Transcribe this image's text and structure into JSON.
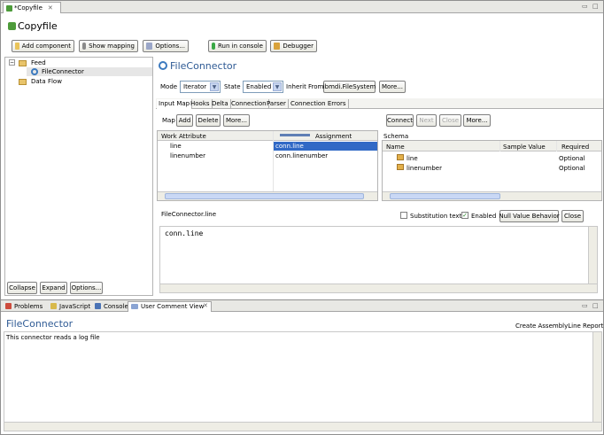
{
  "editor": {
    "tab_title": "*Copyfile",
    "title": "Copyfile"
  },
  "toolbar": {
    "add_component": "Add component",
    "show_mapping": "Show mapping",
    "options": "Options...",
    "run_in_console": "Run in console",
    "debugger": "Debugger"
  },
  "tree": {
    "feed": "Feed",
    "connector": "FileConnector",
    "data_flow": "Data Flow"
  },
  "tree_buttons": {
    "collapse": "Collapse",
    "expand": "Expand",
    "options": "Options..."
  },
  "connector": {
    "title": "FileConnector",
    "mode_label": "Mode",
    "mode_value": "Iterator",
    "state_label": "State",
    "state_value": "Enabled",
    "inherit_label": "Inherit From",
    "inherit_value": "ibmdi.FileSystem",
    "more": "More..."
  },
  "subtabs": [
    "Input Map",
    "Hooks",
    "Delta",
    "Connection",
    "Parser",
    "Connection Errors"
  ],
  "map": {
    "map_label": "Map",
    "add": "Add",
    "delete": "Delete",
    "more": "More...",
    "col_work": "Work Attribute",
    "col_assign": "Assignment",
    "rows": [
      {
        "attr": "line",
        "assign": "conn.line"
      },
      {
        "attr": "linenumber",
        "assign": "conn.linenumber"
      }
    ]
  },
  "schema": {
    "connect": "Connect",
    "next": "Next",
    "close": "Close",
    "more": "More...",
    "title": "Schema",
    "col_name": "Name",
    "col_sample": "Sample Value",
    "col_required": "Required",
    "rows": [
      {
        "name": "line",
        "req": "Optional"
      },
      {
        "name": "linenumber",
        "req": "Optional"
      }
    ]
  },
  "script": {
    "name": "FileConnector.line",
    "subst": "Substitution text",
    "enabled": "Enabled",
    "null_value": "Null Value Behavior",
    "close": "Close",
    "code": "conn.line"
  },
  "bottom_tabs": {
    "problems": "Problems",
    "javascript": "JavaScript",
    "console": "Console",
    "user_comment": "User Comment View"
  },
  "comment": {
    "title": "FileConnector",
    "create_report": "Create AssemblyLine Report",
    "text": "This connector reads a log file"
  }
}
